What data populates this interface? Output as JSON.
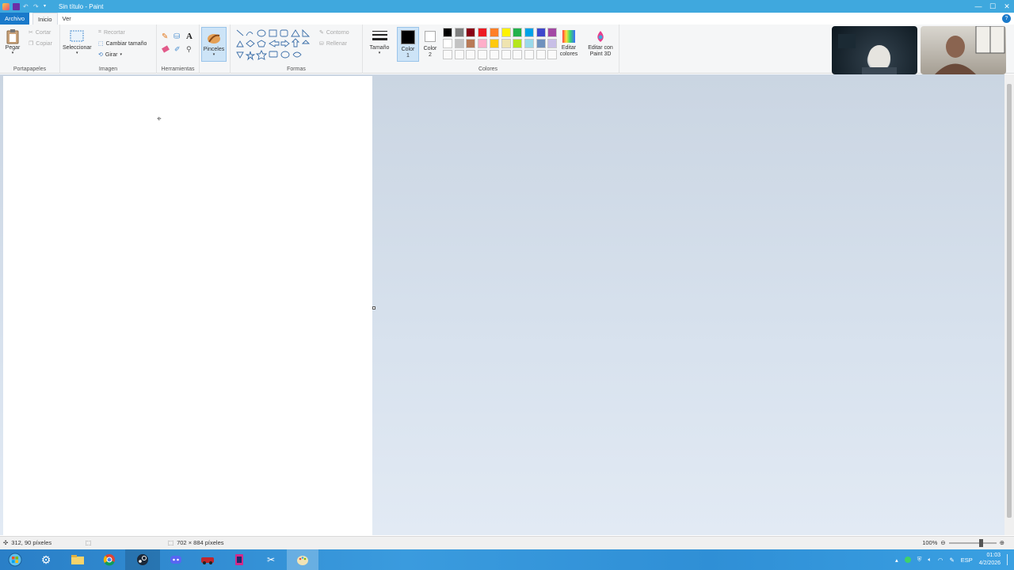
{
  "window": {
    "title": "Sin título - Paint",
    "controls": [
      "—",
      "☐",
      "✕"
    ]
  },
  "menu": {
    "file": "Archivo",
    "home": "Inicio",
    "view": "Ver"
  },
  "ribbon": {
    "clipboard": {
      "label": "Portapapeles",
      "paste": "Pegar",
      "cut": "Cortar",
      "copy": "Copiar"
    },
    "image": {
      "label": "Imagen",
      "select": "Seleccionar",
      "crop": "Recortar",
      "resize": "Cambiar tamaño",
      "rotate": "Girar"
    },
    "tools": {
      "label": "Herramientas"
    },
    "brushes": "Pinceles",
    "shapes": {
      "label": "Formas",
      "outline": "Contorno",
      "fill": "Rellenar"
    },
    "size": "Tamaño",
    "color1": "Color 1",
    "color2": "Color 2",
    "colors": {
      "label": "Colores",
      "edit": "Editar colores",
      "paint3d": "Editar con Paint 3D",
      "palette_row1": [
        "#000000",
        "#7f7f7f",
        "#880015",
        "#ed1c24",
        "#ff7f27",
        "#fff200",
        "#22b14c",
        "#00a2e8",
        "#3f48cc",
        "#a349a4"
      ],
      "palette_row2": [
        "#ffffff",
        "#c3c3c3",
        "#b97a57",
        "#ffaec9",
        "#ffc90e",
        "#efe4b0",
        "#b5e61d",
        "#99d9ea",
        "#7092be",
        "#c8bfe7"
      ]
    }
  },
  "status": {
    "cursor_pos": "312, 90 píxeles",
    "image_size": "702 × 884 píxeles",
    "zoom": "100%"
  },
  "taskbar": {
    "language": "ESP",
    "time": "01:03",
    "date": "4/2/2026"
  }
}
